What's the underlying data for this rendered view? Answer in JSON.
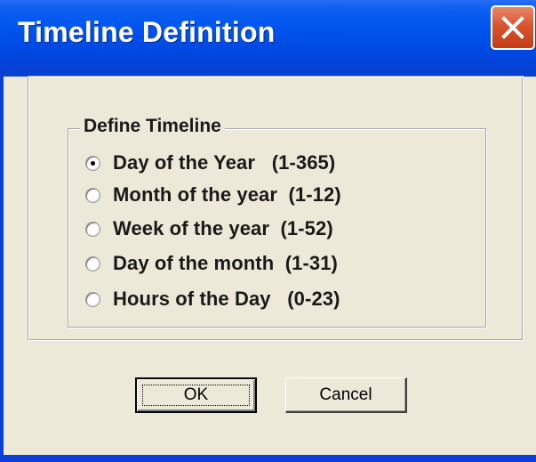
{
  "window": {
    "title": "Timeline Definition",
    "close_icon": "close-icon"
  },
  "group": {
    "label": "Define Timeline",
    "options": [
      {
        "label": "Day of the Year   (1-365)",
        "checked": true
      },
      {
        "label": "Month of the year  (1-12)",
        "checked": false
      },
      {
        "label": "Week of the year  (1-52)",
        "checked": false
      },
      {
        "label": "Day of the month  (1-31)",
        "checked": false
      },
      {
        "label": "Hours of the Day   (0-23)",
        "checked": false
      }
    ]
  },
  "buttons": {
    "ok_label": "OK",
    "cancel_label": "Cancel"
  },
  "colors": {
    "titlebar": "#0053ee",
    "dialog_face": "#ece9d8",
    "close_button": "#d8542e"
  }
}
